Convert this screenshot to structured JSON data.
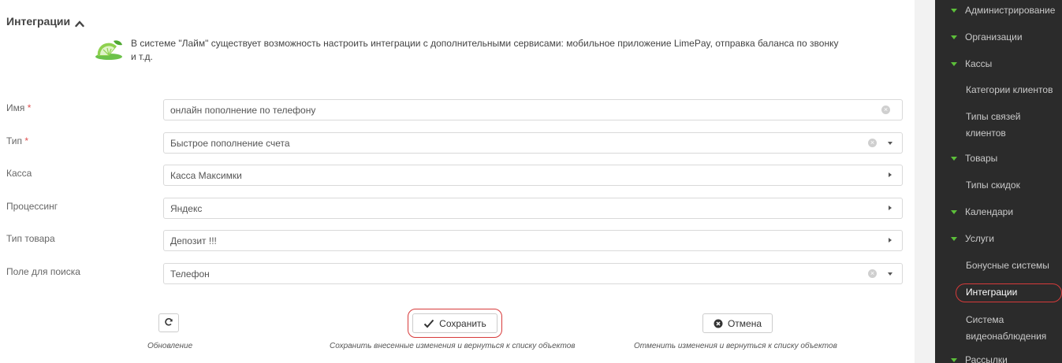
{
  "section": {
    "title": "Интеграции",
    "toggle_icon": "chevron-up-icon"
  },
  "intro": {
    "icon": "lime-logo-icon",
    "text": "В системе \"Лайм\" существует возможность настроить интеграции с дополнительными сервисами: мобильное приложение LimePay, отправка баланса по звонку и т.д."
  },
  "form": {
    "required_mark": "*",
    "fields": [
      {
        "label": "Имя",
        "required": true,
        "value": "онлайн пополнение по телефону",
        "control": "text-clearable"
      },
      {
        "label": "Тип",
        "required": true,
        "value": "Быстрое пополнение счета",
        "control": "select-clearable"
      },
      {
        "label": "Касса",
        "required": false,
        "value": "Касса Максимки",
        "control": "lookup"
      },
      {
        "label": "Процессинг",
        "required": false,
        "value": "Яндекс",
        "control": "lookup"
      },
      {
        "label": "Тип товара",
        "required": false,
        "value": "Депозит !!!",
        "control": "lookup"
      },
      {
        "label": "Поле для поиска",
        "required": false,
        "value": "Телефон",
        "control": "select-clearable"
      }
    ]
  },
  "actions": {
    "refresh": {
      "icon": "refresh-icon",
      "caption": "Обновление"
    },
    "save": {
      "icon": "checkmark-icon",
      "label": "Сохранить",
      "caption": "Сохранить внесенные изменения и вернуться к списку объектов"
    },
    "cancel": {
      "icon": "x-circle-icon",
      "label": "Отмена",
      "caption": "Отменить изменения и вернуться к списку объектов"
    }
  },
  "sidebar": {
    "accent_color": "#5cbf3a",
    "items": [
      {
        "type": "group",
        "label": "Администрирование"
      },
      {
        "type": "group",
        "label": "Организации"
      },
      {
        "type": "group",
        "label": "Кассы"
      },
      {
        "type": "link",
        "label": "Категории клиентов"
      },
      {
        "type": "link",
        "label": "Типы связей клиентов"
      },
      {
        "type": "group",
        "label": "Товары"
      },
      {
        "type": "link",
        "label": "Типы скидок"
      },
      {
        "type": "group",
        "label": "Календари"
      },
      {
        "type": "group",
        "label": "Услуги"
      },
      {
        "type": "link",
        "label": "Бонусные системы"
      },
      {
        "type": "link",
        "label": "Интеграции",
        "active": true
      },
      {
        "type": "link",
        "label": "Система видеонаблюдения"
      },
      {
        "type": "group",
        "label": "Рассылки"
      }
    ]
  },
  "highlight_color": "#d73a3a"
}
